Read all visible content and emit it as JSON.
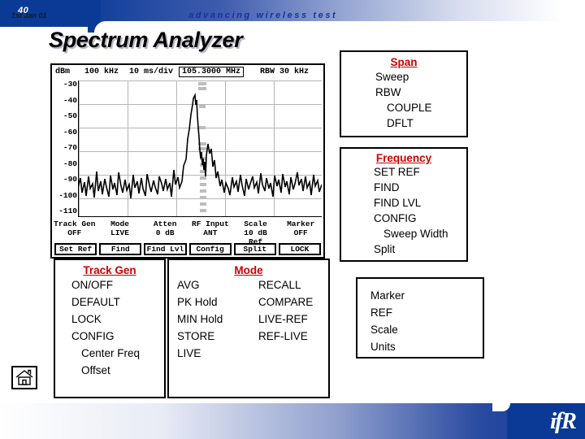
{
  "slide": {
    "number": "40",
    "title": "Spectrum Analyzer"
  },
  "analyzer": {
    "status_bar": {
      "units": "dBm",
      "span": "100 kHz",
      "time_div": "10 ms/div",
      "center_freq": "105.3000 MHz",
      "rbw_label": "RBW",
      "rbw_value": "30 kHz"
    },
    "y_axis": [
      "-30",
      "-40",
      "-50",
      "-60",
      "-70",
      "-80",
      "-90",
      "-100",
      "-110"
    ],
    "params": [
      {
        "label": "Track Gen",
        "value": "OFF"
      },
      {
        "label": "Mode",
        "value": "LIVE"
      },
      {
        "label": "Atten",
        "value": "0 dB"
      },
      {
        "label": "RF Input",
        "value": "ANT"
      },
      {
        "label": "Scale",
        "value": "10 dB",
        "value2": "Ref"
      },
      {
        "label": "Marker",
        "value": "OFF"
      }
    ],
    "softkeys": [
      "Set Ref",
      "Find",
      "Find Lvl",
      "Config",
      "Split",
      "LOCK"
    ]
  },
  "panels": {
    "span": {
      "header": "Span",
      "items": [
        "Sweep",
        "RBW",
        "COUPLE",
        "DFLT"
      ],
      "indented": [
        false,
        false,
        true,
        true
      ]
    },
    "frequency": {
      "header": "Frequency",
      "items": [
        "SET REF",
        "FIND",
        "FIND LVL",
        "CONFIG",
        "Sweep Width",
        "Split"
      ],
      "indented": [
        false,
        false,
        false,
        false,
        true,
        false
      ]
    },
    "marker": {
      "items": [
        "Marker",
        "REF",
        "Scale",
        "Units"
      ]
    },
    "track_gen": {
      "header": "Track Gen",
      "items": [
        "ON/OFF",
        "DEFAULT",
        "LOCK",
        "CONFIG",
        "Center Freq",
        "Offset"
      ],
      "indented": [
        false,
        false,
        false,
        false,
        true,
        true
      ]
    },
    "mode": {
      "header": "Mode",
      "col1": [
        "AVG",
        "PK Hold",
        "MIN Hold",
        "STORE",
        "LIVE"
      ],
      "col2": [
        "RECALL",
        "COMPARE",
        "LIVE-REF",
        "REF-LIVE"
      ]
    }
  },
  "footer": {
    "date": "1st Jan 01",
    "tagline": "advancing wireless test",
    "logo": "ifR"
  },
  "colors": {
    "brand_blue": "#0a3a96",
    "header_red": "#cc0000",
    "tagline_blue": "#15349a"
  }
}
